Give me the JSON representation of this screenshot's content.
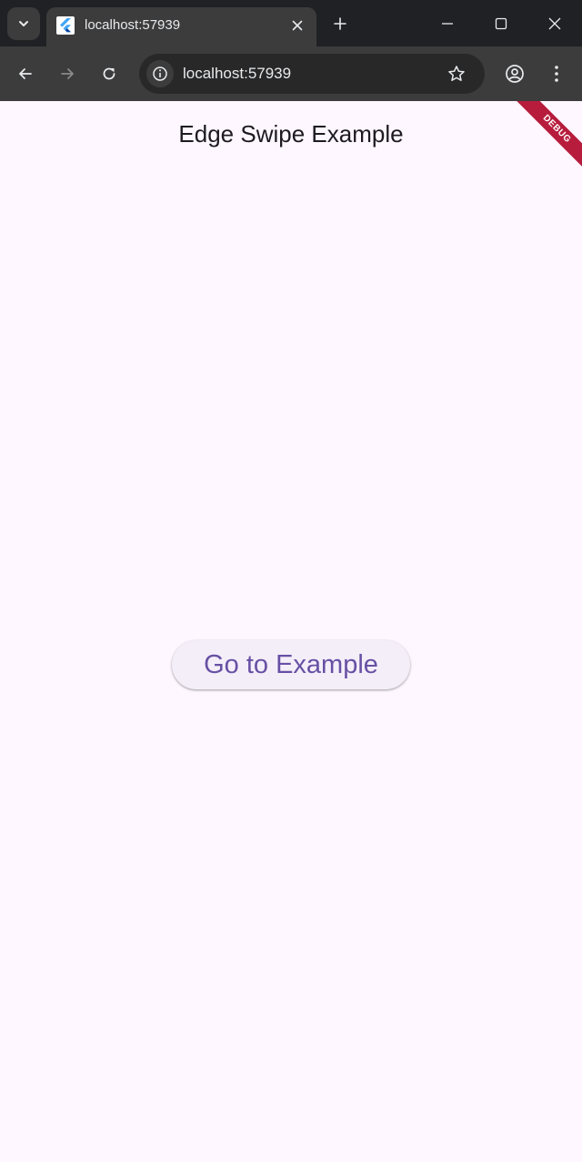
{
  "browser": {
    "tab": {
      "title": "localhost:57939"
    },
    "address_bar": {
      "url": "localhost:57939"
    },
    "icons": {
      "tab_search": "chevron-down-icon",
      "favicon": "flutter-logo-icon",
      "tab_close": "close-icon",
      "new_tab": "plus-icon",
      "minimize": "minimize-icon",
      "maximize": "maximize-icon",
      "close_window": "close-icon",
      "back": "arrow-left-icon",
      "forward": "arrow-right-icon",
      "reload": "reload-icon",
      "site_info": "info-icon",
      "bookmark": "star-icon",
      "profile": "profile-icon",
      "menu": "kebab-menu-icon"
    }
  },
  "app": {
    "title": "Edge Swipe Example",
    "button_label": "Go to Example",
    "debug_banner": "DEBUG"
  },
  "colors": {
    "page_background": "#fef7ff",
    "button_text": "#6750a4",
    "button_background": "#f4eef9",
    "debug_banner": "#b71c3c",
    "browser_frame": "#202124",
    "toolbar": "#3c3c3c"
  }
}
